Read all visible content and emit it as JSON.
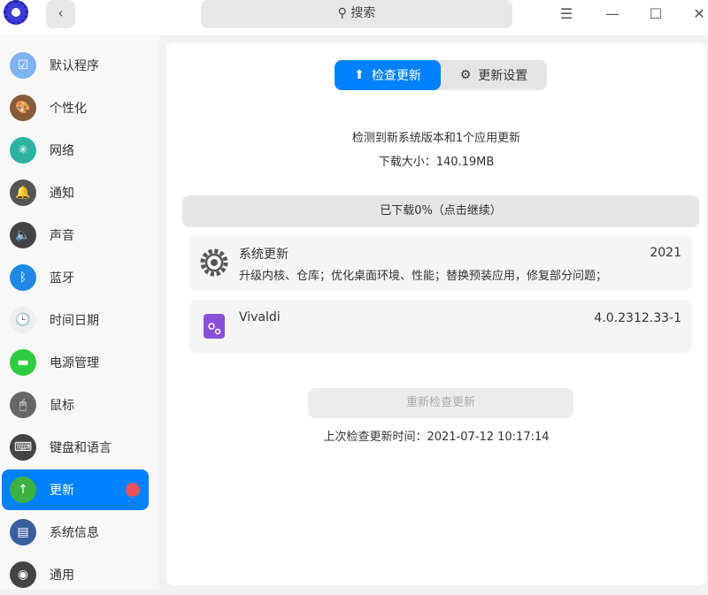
{
  "titlebar": {
    "search_placeholder": "搜索",
    "back": "‹",
    "menu": "☰",
    "minimize": "—",
    "maximize": "☐",
    "close": "✕"
  },
  "sidebar": {
    "items": [
      {
        "label": "默认程序",
        "color": "#7fb3f0"
      },
      {
        "label": "个性化",
        "color": "#8a5a3c"
      },
      {
        "label": "网络",
        "color": "#2bb3a0"
      },
      {
        "label": "通知",
        "color": "#555555"
      },
      {
        "label": "声音",
        "color": "#444444"
      },
      {
        "label": "蓝牙",
        "color": "#1e88e5"
      },
      {
        "label": "时间日期",
        "color": "#eeeeee"
      },
      {
        "label": "电源管理",
        "color": "#2ecc40"
      },
      {
        "label": "鼠标",
        "color": "#666666"
      },
      {
        "label": "键盘和语言",
        "color": "#444444"
      },
      {
        "label": "更新",
        "color": "#3cb043"
      },
      {
        "label": "系统信息",
        "color": "#3a5fa0"
      },
      {
        "label": "通用",
        "color": "#444444"
      }
    ],
    "active": "更新"
  },
  "tabs": [
    {
      "label": "检查更新",
      "active": true
    },
    {
      "label": "更新设置",
      "active": false
    }
  ],
  "summary": {
    "line1": "检测到新系统版本和1个应用更新",
    "line2": "下载大小：140.19MB"
  },
  "progress": {
    "label": "已下载0%（点击继续）",
    "percent": 0
  },
  "updates": [
    {
      "title": "系统更新",
      "desc": "升级内核、仓库；优化桌面环境、性能；替换预装应用，修复部分问题；",
      "version": "2021"
    },
    {
      "title": "Vivaldi",
      "desc": "",
      "version": "4.0.2312.33-1"
    }
  ],
  "recheck_label": "重新检查更新",
  "last_check": "上次检查更新时间：2021-07-12 10:17:14",
  "accent": "#0081ff"
}
